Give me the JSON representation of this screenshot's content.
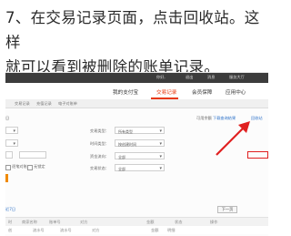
{
  "caption": {
    "line1": "7、在交易记录页面，点击回收站。这样",
    "line2": "就可以看到被删除的账单记录。"
  },
  "topbar": {
    "user": "你好,",
    "logout": "退出",
    "messages": "消息",
    "service": "服务大厅"
  },
  "nav": {
    "my_alipay": "我的支付宝",
    "records": "交易记录",
    "member": "会员保障",
    "apps": "应用中心"
  },
  "tabs": {
    "t1": "交易记录",
    "t2": "充值记录",
    "t3": "电子对账单"
  },
  "toolbar": {
    "ratio_label": "可用余额",
    "download_link": "下载查询结果",
    "recycle_link": "回收站"
  },
  "filters": {
    "trade_type_label": "交易类型：",
    "trade_type_value": "所有类型",
    "time_label": "时间类型：",
    "time_value": "按创建时间",
    "amount_label": "资金流向：",
    "amount_value": "全部",
    "status_label": "交易状态：",
    "status_value": "全部",
    "option1": "逐笔对账",
    "option2": "无锁定"
  },
  "left_labels": {
    "r": "日",
    "last7": "近7日"
  },
  "pager": {
    "next": "下一页"
  },
  "table": {
    "headers": [
      "时",
      "商家名称",
      "账单号",
      "对方",
      "金额",
      "状态",
      "操作"
    ],
    "headers2": [
      "创",
      "流水号",
      "流水号",
      "对方",
      "金额",
      "明细",
      ""
    ]
  },
  "colors": {
    "accent": "#e8380d",
    "highlight": "#e02020"
  }
}
